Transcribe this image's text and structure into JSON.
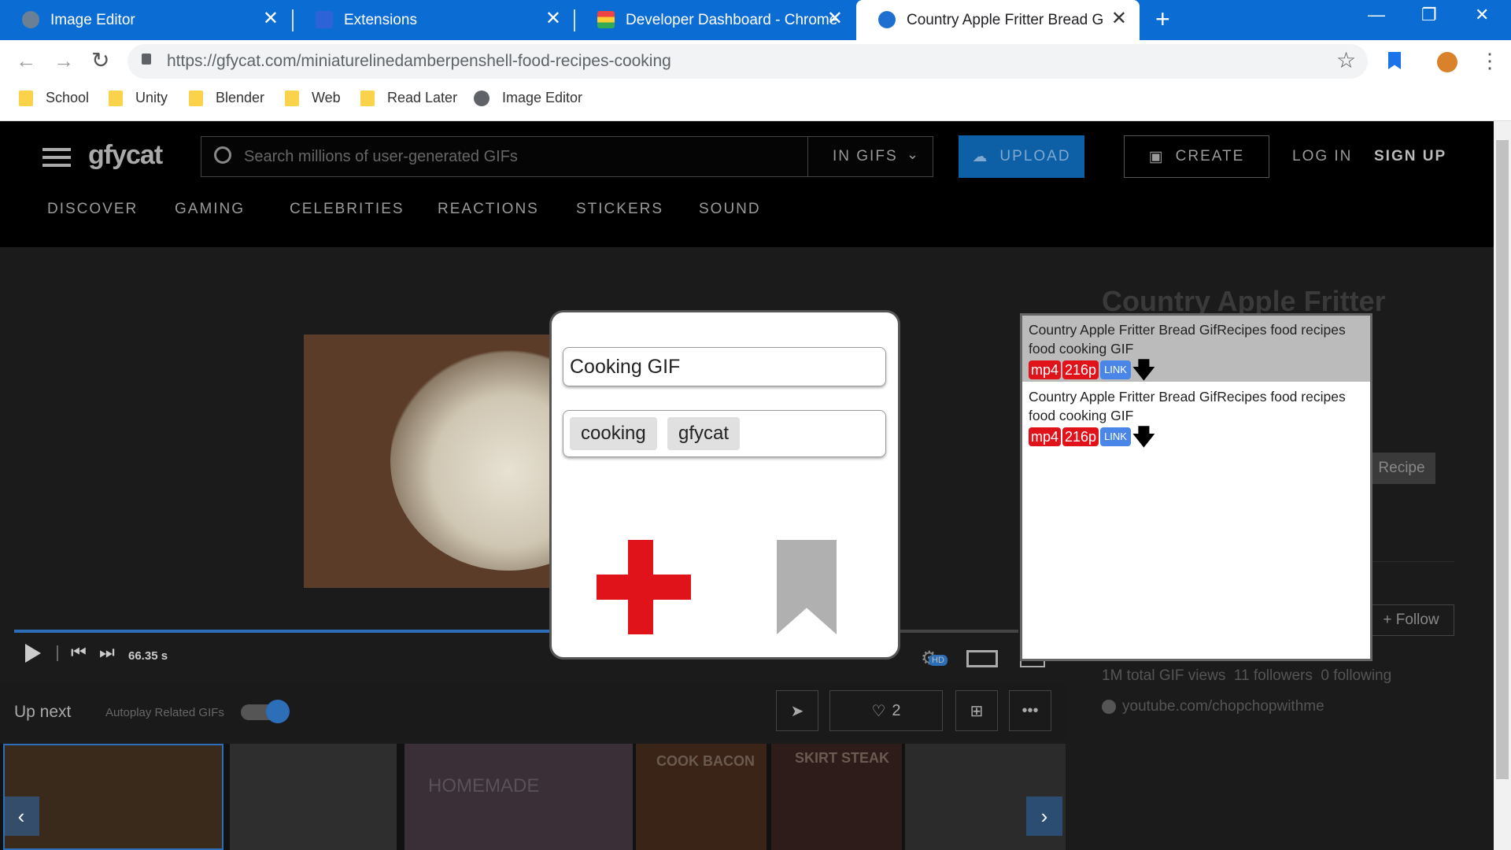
{
  "browser": {
    "tabs": [
      {
        "title": "Image Editor",
        "active": false
      },
      {
        "title": "Extensions",
        "active": false
      },
      {
        "title": "Developer Dashboard - Chrome",
        "active": false
      },
      {
        "title": "Country Apple Fritter Bread GIF b",
        "active": true
      }
    ],
    "new_tab": "+",
    "url_domain": "https://gfycat.com/",
    "url_path": "miniaturelinedamberpenshell-food-recipes-cooking",
    "bookmarks": [
      "School",
      "Unity",
      "Blender",
      "Web",
      "Read Later",
      "Image Editor"
    ]
  },
  "site": {
    "logo": "gfycat",
    "search_placeholder": "Search millions of user-generated GIFs",
    "search_scope": "IN GIFS",
    "upload_label": "UPLOAD",
    "create_label": "CREATE",
    "login_label": "LOG IN",
    "signup_label": "SIGN UP",
    "nav": [
      "DISCOVER",
      "GAMING",
      "CELEBRITIES",
      "REACTIONS",
      "STICKERS",
      "SOUND"
    ]
  },
  "player": {
    "time": "66.35 s",
    "hd_badge": "HD",
    "progress_fraction": 0.55,
    "upnext_label": "Up next",
    "autoplay_label": "Autoplay Related GIFs",
    "likes": "2",
    "thumb_labels": [
      "COOK BACON",
      "SKIRT STEAK",
      "HOMEMADE"
    ]
  },
  "info": {
    "title": "Country Apple Fritter",
    "tag": "Recipe",
    "follow_label": "+ Follow",
    "stats": "1M total GIF views  11 followers  0 following",
    "link": "youtube.com/chopchopwithme"
  },
  "popup_save": {
    "title_value": "Cooking GIF",
    "tags": [
      "cooking",
      "gfycat"
    ]
  },
  "popup_downloads": {
    "items": [
      {
        "text": "Country Apple Fritter Bread GifRecipes food recipes food cooking GIF",
        "format": "mp4",
        "quality": "216p",
        "link": "LINK",
        "highlighted": true
      },
      {
        "text": "Country Apple Fritter Bread GifRecipes food recipes food cooking GIF",
        "format": "mp4",
        "quality": "216p",
        "link": "LINK",
        "highlighted": false
      }
    ]
  },
  "colors": {
    "chrome_blue": "#0b6dd4",
    "add_red": "#e0121a",
    "bookmark_gray": "#b0b0b0",
    "link_blue": "#4a86e8"
  }
}
